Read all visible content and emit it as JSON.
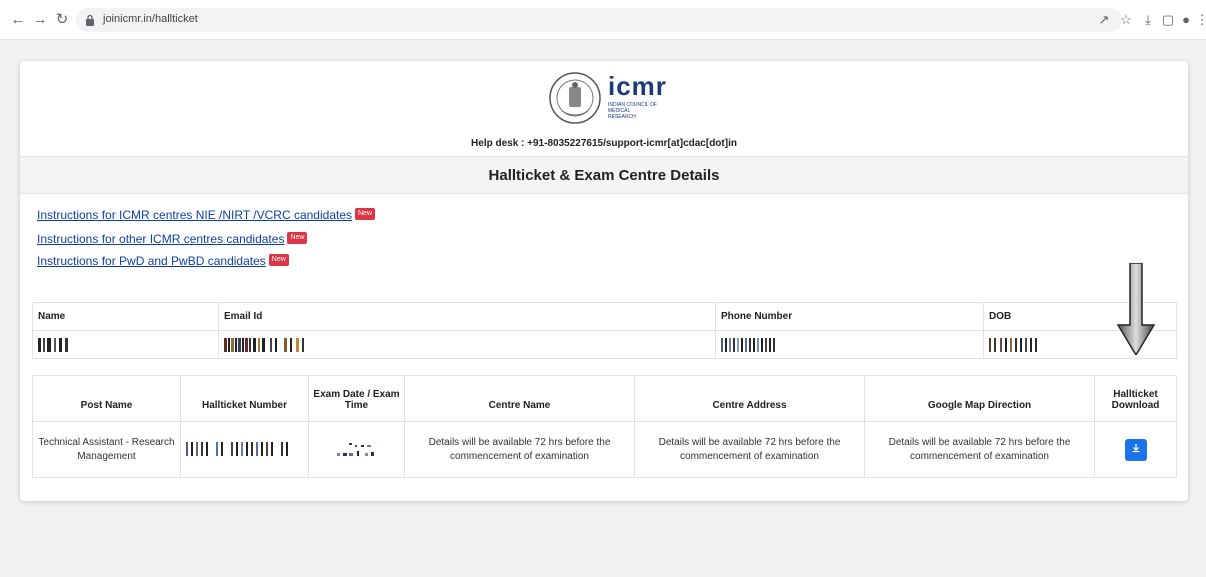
{
  "browser": {
    "url": "joinicmr.in/hallticket"
  },
  "header": {
    "logo_word": "icmr",
    "logo_sub": "Indian Council of Medical Research",
    "helpdesk": "Help desk : +91-8035227615/support-icmr[at]cdac[dot]in",
    "section_title": "Hallticket & Exam Centre Details"
  },
  "instructions": [
    {
      "label": "Instructions for ICMR centres NIE /NIRT /VCRC candidates",
      "badge": "New"
    },
    {
      "label": "Instructions for other ICMR centres candidates",
      "badge": "New"
    },
    {
      "label": "Instructions for PwD and PwBD candidates",
      "badge": "New"
    }
  ],
  "candidate": {
    "headers": [
      "Name",
      "Email Id",
      "Phone Number",
      "DOB"
    ]
  },
  "exam": {
    "headers": [
      "Post Name",
      "Hallticket Number",
      "Exam Date / Exam Time",
      "Centre Name",
      "Centre Address",
      "Google Map Direction",
      "Hallticket Download"
    ],
    "row": {
      "post_name": "Technical Assistant - Research Management",
      "centre_name": "Details will be available 72 hrs before the commencement of examination",
      "centre_address": "Details will be available 72 hrs before the commencement of examination",
      "map_direction": "Details will be available 72 hrs before the commencement of examination"
    }
  },
  "colors": {
    "link": "#0d3fa8",
    "badge": "#dc3545",
    "download_button": "#1a73e8"
  }
}
